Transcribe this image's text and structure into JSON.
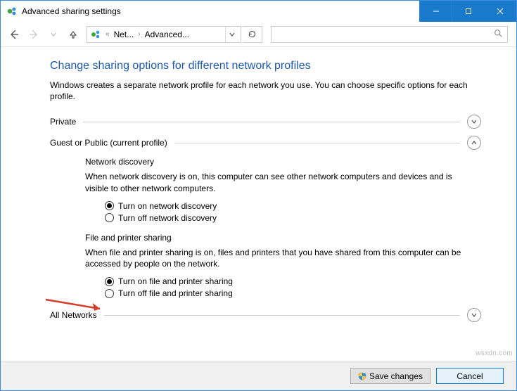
{
  "titlebar": {
    "title": "Advanced sharing settings"
  },
  "breadcrumb": {
    "item1": "Net...",
    "item2": "Advanced..."
  },
  "page": {
    "heading": "Change sharing options for different network profiles",
    "description": "Windows creates a separate network profile for each network you use. You can choose specific options for each profile."
  },
  "sections": {
    "private": {
      "label": "Private"
    },
    "guest": {
      "label": "Guest or Public (current profile)",
      "network_discovery": {
        "title": "Network discovery",
        "desc": "When network discovery is on, this computer can see other network computers and devices and is visible to other network computers.",
        "opt_on": "Turn on network discovery",
        "opt_off": "Turn off network discovery"
      },
      "file_printer": {
        "title": "File and printer sharing",
        "desc": "When file and printer sharing is on, files and printers that you have shared from this computer can be accessed by people on the network.",
        "opt_on": "Turn on file and printer sharing",
        "opt_off": "Turn off file and printer sharing"
      }
    },
    "all": {
      "label": "All Networks"
    }
  },
  "footer": {
    "save": "Save changes",
    "cancel": "Cancel"
  },
  "watermark": "wsxdn.com"
}
